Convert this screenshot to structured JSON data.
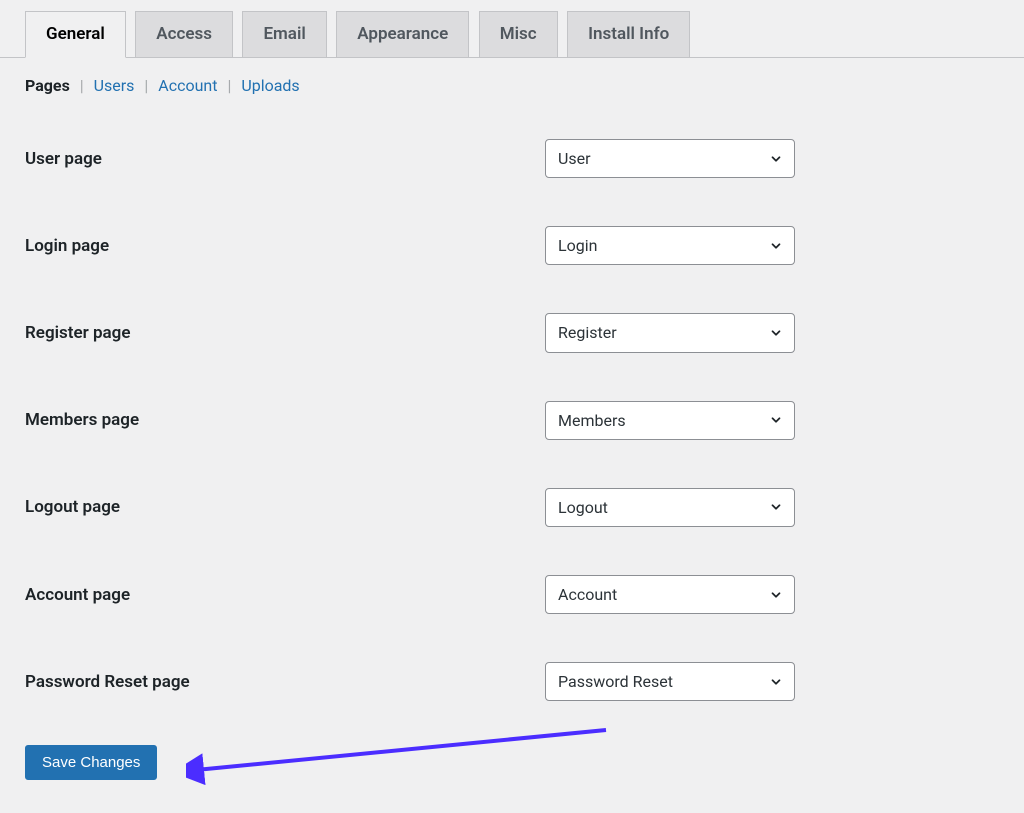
{
  "tabs": [
    {
      "label": "General",
      "active": true
    },
    {
      "label": "Access",
      "active": false
    },
    {
      "label": "Email",
      "active": false
    },
    {
      "label": "Appearance",
      "active": false
    },
    {
      "label": "Misc",
      "active": false
    },
    {
      "label": "Install Info",
      "active": false
    }
  ],
  "subnav": [
    {
      "label": "Pages",
      "current": true
    },
    {
      "label": "Users",
      "current": false
    },
    {
      "label": "Account",
      "current": false
    },
    {
      "label": "Uploads",
      "current": false
    }
  ],
  "fields": [
    {
      "label": "User page",
      "value": "User"
    },
    {
      "label": "Login page",
      "value": "Login"
    },
    {
      "label": "Register page",
      "value": "Register"
    },
    {
      "label": "Members page",
      "value": "Members"
    },
    {
      "label": "Logout page",
      "value": "Logout"
    },
    {
      "label": "Account page",
      "value": "Account"
    },
    {
      "label": "Password Reset page",
      "value": "Password Reset"
    }
  ],
  "buttons": {
    "save": "Save Changes"
  }
}
